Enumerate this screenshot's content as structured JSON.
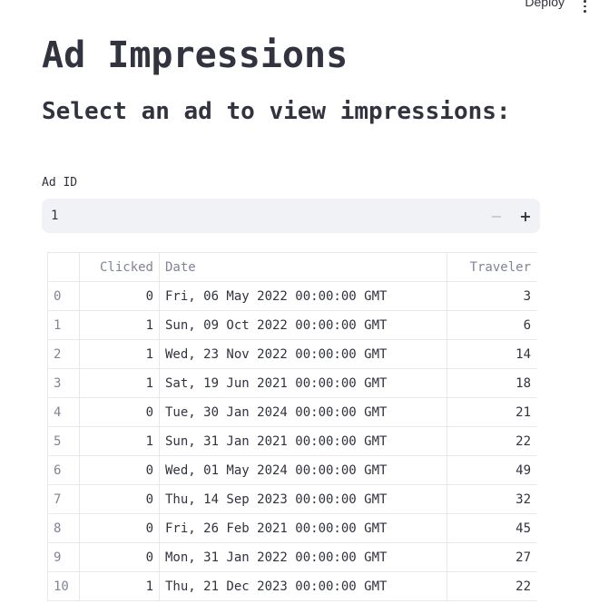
{
  "header": {
    "deploy_label": "Deploy",
    "menu_icon": "vertical-dots-icon"
  },
  "page": {
    "title": "Ad Impressions",
    "subtitle": "Select an ad to view impressions:"
  },
  "ad_input": {
    "label": "Ad ID",
    "value": "1",
    "minus_label": "−",
    "plus_label": "+"
  },
  "table": {
    "columns": [
      "",
      "Clicked",
      "Date",
      "Traveler"
    ],
    "rows": [
      {
        "index": "0",
        "clicked": "0",
        "date": "Fri, 06 May 2022 00:00:00 GMT",
        "traveler": "3"
      },
      {
        "index": "1",
        "clicked": "1",
        "date": "Sun, 09 Oct 2022 00:00:00 GMT",
        "traveler": "6"
      },
      {
        "index": "2",
        "clicked": "1",
        "date": "Wed, 23 Nov 2022 00:00:00 GMT",
        "traveler": "14"
      },
      {
        "index": "3",
        "clicked": "1",
        "date": "Sat, 19 Jun 2021 00:00:00 GMT",
        "traveler": "18"
      },
      {
        "index": "4",
        "clicked": "0",
        "date": "Tue, 30 Jan 2024 00:00:00 GMT",
        "traveler": "21"
      },
      {
        "index": "5",
        "clicked": "1",
        "date": "Sun, 31 Jan 2021 00:00:00 GMT",
        "traveler": "22"
      },
      {
        "index": "6",
        "clicked": "0",
        "date": "Wed, 01 May 2024 00:00:00 GMT",
        "traveler": "49"
      },
      {
        "index": "7",
        "clicked": "0",
        "date": "Thu, 14 Sep 2023 00:00:00 GMT",
        "traveler": "32"
      },
      {
        "index": "8",
        "clicked": "0",
        "date": "Fri, 26 Feb 2021 00:00:00 GMT",
        "traveler": "45"
      },
      {
        "index": "9",
        "clicked": "0",
        "date": "Mon, 31 Jan 2022 00:00:00 GMT",
        "traveler": "27"
      },
      {
        "index": "10",
        "clicked": "1",
        "date": "Thu, 21 Dec 2023 00:00:00 GMT",
        "traveler": "22"
      }
    ]
  }
}
